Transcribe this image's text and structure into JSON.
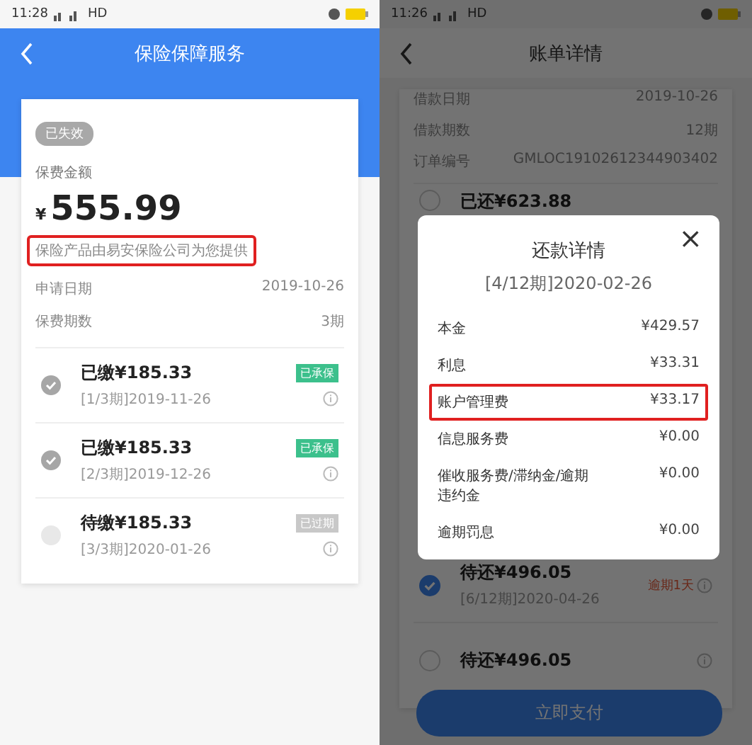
{
  "insurance_screen": {
    "status_bar": {
      "time": "11:28",
      "network": "HD"
    },
    "title": "保险保障服务",
    "status_badge": "已失效",
    "premium_label": "保费金额",
    "currency": "¥",
    "amount": "555.99",
    "provider_note": {
      "text": "保险产品由易安保险公司为您提供",
      "highlighted": true
    },
    "details": [
      {
        "label": "申请日期",
        "value": "2019-10-26"
      },
      {
        "label": "保费期数",
        "value": "3期"
      }
    ],
    "installments": [
      {
        "title": "已缴¥185.33",
        "period": "[1/3期]2019-11-26",
        "tag": "已承保",
        "paid": true,
        "color": "#3cc08c"
      },
      {
        "title": "已缴¥185.33",
        "period": "[2/3期]2019-12-26",
        "tag": "已承保",
        "paid": true,
        "color": "#3cc08c"
      },
      {
        "title": "待缴¥185.33",
        "period": "[3/3期]2020-01-26",
        "tag": "已过期",
        "paid": false,
        "color": "#c8c8c8"
      }
    ]
  },
  "bill_screen": {
    "status_bar": {
      "time": "11:26",
      "network": "HD"
    },
    "title": "账单详情",
    "details": [
      {
        "label": "借款日期",
        "value": "2019-10-26"
      },
      {
        "label": "借款期数",
        "value": "12期"
      },
      {
        "label": "订单编号",
        "value": "GMLOC19102612344903402"
      }
    ],
    "installments": [
      {
        "title": "已还¥623.88",
        "selected": false
      },
      {
        "title": "待还¥496.05",
        "period": "[6/12期]2020-04-26",
        "overdue": "逾期1天",
        "selected": true
      },
      {
        "title": "待还¥496.05",
        "selected": false
      }
    ],
    "pay_button": "立即支付",
    "dialog": {
      "title": "还款详情",
      "subtitle": "[4/12期]2020-02-26",
      "close": "×",
      "rows": [
        {
          "label": "本金",
          "value": "¥429.57",
          "highlighted": false
        },
        {
          "label": "利息",
          "value": "¥33.31",
          "highlighted": false
        },
        {
          "label": "账户管理费",
          "value": "¥33.17",
          "highlighted": true
        },
        {
          "label": "信息服务费",
          "value": "¥0.00",
          "highlighted": false
        },
        {
          "label": "催收服务费/滞纳金/逾期违约金",
          "value": "¥0.00",
          "highlighted": false
        },
        {
          "label": "逾期罚息",
          "value": "¥0.00",
          "highlighted": false
        }
      ]
    }
  }
}
